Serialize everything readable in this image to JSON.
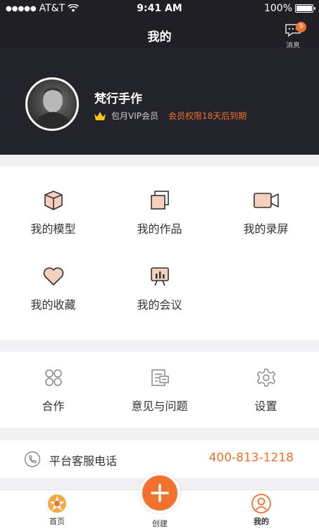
{
  "status_bar": {
    "carrier": "AT&T",
    "time": "9:41 AM",
    "battery": "100%"
  },
  "nav": {
    "title": "我的",
    "messages_label": "消息",
    "messages_badge": "9"
  },
  "profile": {
    "name": "梵行手作",
    "vip_label": "包月VIP会员",
    "vip_expire": "会员权限18天后到期"
  },
  "features": [
    {
      "label": "我的模型",
      "icon": "cube-icon"
    },
    {
      "label": "我的作品",
      "icon": "stack-icon"
    },
    {
      "label": "我的录屏",
      "icon": "video-camera-icon"
    },
    {
      "label": "我的收藏",
      "icon": "heart-icon"
    },
    {
      "label": "我的会议",
      "icon": "presentation-board-icon"
    }
  ],
  "tools": [
    {
      "label": "合作",
      "icon": "cooperation-icon"
    },
    {
      "label": "意见与问题",
      "icon": "feedback-icon"
    },
    {
      "label": "设置",
      "icon": "gear-icon"
    }
  ],
  "service": {
    "label": "平台客服电话",
    "phone": "400-813-1218"
  },
  "tabs": {
    "home": "首页",
    "create": "创建",
    "mine": "我的"
  },
  "colors": {
    "accent": "#f07030",
    "dark": "#23232b",
    "icon_fill": "#f6cfbd"
  }
}
